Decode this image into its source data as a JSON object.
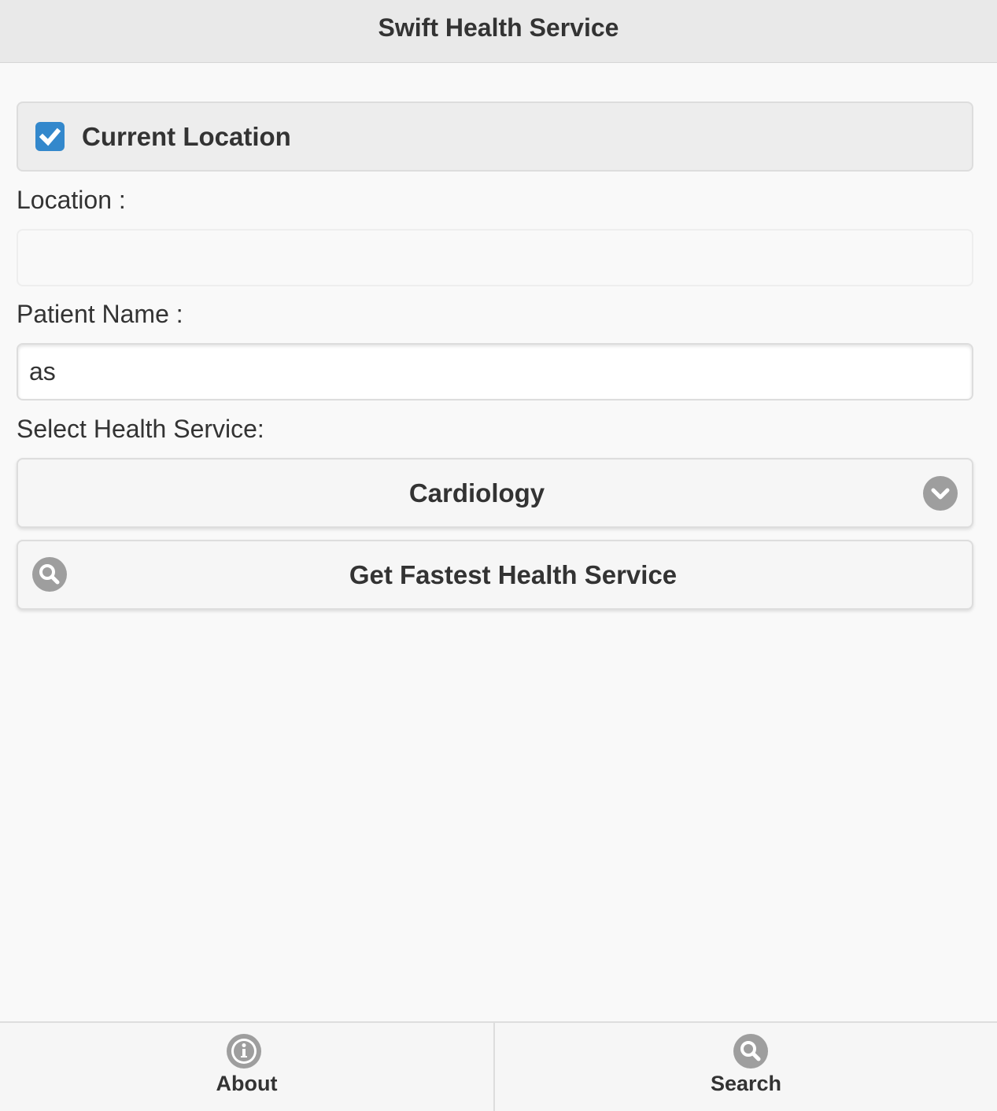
{
  "header": {
    "title": "Swift Health Service"
  },
  "form": {
    "current_location": {
      "label": "Current Location",
      "checked": true
    },
    "location": {
      "label": "Location :",
      "value": ""
    },
    "patient_name": {
      "label": "Patient Name :",
      "value": "as"
    },
    "health_service": {
      "label": "Select Health Service:",
      "selected": "Cardiology"
    },
    "submit": {
      "label": "Get Fastest Health Service"
    }
  },
  "footer": {
    "tabs": [
      {
        "label": "About",
        "icon": "info-icon"
      },
      {
        "label": "Search",
        "icon": "search-icon"
      }
    ]
  },
  "colors": {
    "accent": "#3388cc",
    "icon_gray": "#9e9e9e",
    "bar_background": "#e9e9e9"
  }
}
